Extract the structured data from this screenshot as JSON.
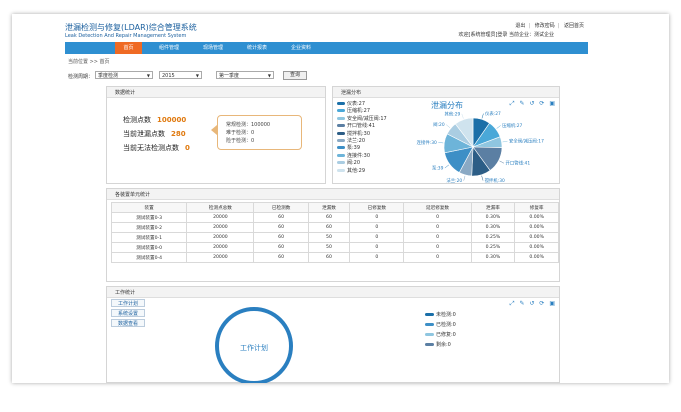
{
  "header": {
    "title_cn": "泄漏检测与修复(LDAR)综合管理系统",
    "title_en": "Leak Detection And Repair Management System",
    "links": [
      "退出",
      "修改密码",
      "返回首页"
    ],
    "user_info": "欢迎[系统管理员]登录  当前企业：测试企业"
  },
  "nav": {
    "items": [
      "首页",
      "组件管理",
      "现场管理",
      "统计报表",
      "企业资料"
    ],
    "active_index": 0
  },
  "breadcrumb": "当前位置 >> 首页",
  "filter": {
    "label": "检测周期：",
    "period_type": "季度检测",
    "year": "2015",
    "quarter": "第一季度",
    "query_label": "查询"
  },
  "stats_panel": {
    "title": "数据统计",
    "detect_label": "检测点数",
    "detect_value": "100000",
    "leak_label": "当前泄漏点数",
    "leak_value": "280",
    "undetectable_label": "当前无法检测点数",
    "undetectable_value": "0",
    "callout": [
      "常规检测：100000",
      "难于检测：0",
      "险于检测：0"
    ]
  },
  "leak_panel": {
    "title": "泄漏分布",
    "chart_title": "泄漏分布",
    "toolbar_icons": [
      "zoom-icon",
      "edit-icon",
      "restore-icon",
      "refresh-icon",
      "save-icon"
    ]
  },
  "chart_data": {
    "type": "pie",
    "title": "泄漏分布",
    "categories": [
      "仪表",
      "压缩机",
      "安全阀/减压阀",
      "开口管线",
      "搅拌机",
      "法兰",
      "泵",
      "连接件",
      "阀",
      "其他"
    ],
    "values": [
      27,
      27,
      17,
      41,
      30,
      20,
      39,
      30,
      20,
      29
    ],
    "legend": [
      "仪表:27",
      "压缩机:27",
      "安全阀/减压阀:17",
      "开口管线:41",
      "搅拌机:30",
      "法兰:20",
      "泵:39",
      "连接件:30",
      "阀:20",
      "其他:29"
    ],
    "slice_labels": [
      "仪表:27",
      "压缩机:27",
      "安全阀/减压阀:17",
      "开口管线:41",
      "搅拌机:30",
      "法兰:20",
      "泵:39",
      "连接件:30",
      "阀:20",
      "其他:29"
    ],
    "colors": [
      "#1a6fa8",
      "#4aa8d8",
      "#8fc6e0",
      "#5b7fa3",
      "#2c5d86",
      "#8aa9c4",
      "#3d8fc6",
      "#6db4d9",
      "#aacde2",
      "#cfe3ee"
    ],
    "legend_placement": "left"
  },
  "device_panel": {
    "title": "各装置单元统计",
    "columns": [
      "装置",
      "检测点总数",
      "已检测数",
      "泄漏数",
      "已修复数",
      "延迟修复数",
      "泄漏率",
      "修复率"
    ],
    "rows": [
      [
        "测试装置0-3",
        "20000",
        "60",
        "60",
        "0",
        "0",
        "0.30%",
        "0.00%"
      ],
      [
        "测试装置0-2",
        "20000",
        "60",
        "60",
        "0",
        "0",
        "0.30%",
        "0.00%"
      ],
      [
        "测试装置0-1",
        "20000",
        "60",
        "50",
        "0",
        "0",
        "0.25%",
        "0.00%"
      ],
      [
        "测试装置0-0",
        "20000",
        "60",
        "50",
        "0",
        "0",
        "0.25%",
        "0.00%"
      ],
      [
        "测试装置0-4",
        "20000",
        "60",
        "60",
        "0",
        "0",
        "0.30%",
        "0.00%"
      ]
    ]
  },
  "work_panel": {
    "title": "工作统计",
    "buttons": [
      "工作计划",
      "系统设置",
      "数据查看"
    ],
    "circle_label": "工作计划",
    "legend": [
      "未检测:0",
      "已检测:0",
      "已修复:0",
      "剩余:0"
    ],
    "legend_colors": [
      "#1a6fa8",
      "#3d8fc6",
      "#8fc6e0",
      "#5b7fa3"
    ]
  }
}
